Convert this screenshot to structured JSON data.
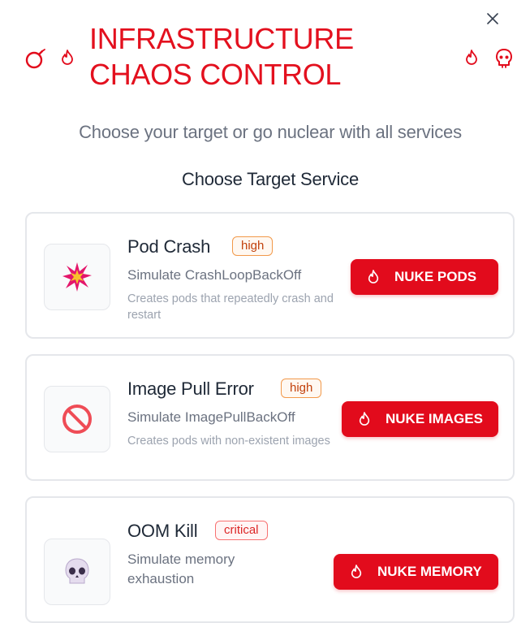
{
  "dialog": {
    "title_line1": "INFRASTRUCTURE",
    "title_line2": "CHAOS CONTROL",
    "subtitle": "Choose your target or go nuclear with all services",
    "section_title": "Choose Target Service",
    "close_icon": "close-icon",
    "header_icons": [
      "bomb-icon",
      "fire-icon",
      "fire-icon",
      "skull-icon"
    ]
  },
  "colors": {
    "accent": "#e20b1c",
    "badge_high": "#f2994a",
    "badge_critical": "#f87171"
  },
  "services": [
    {
      "name": "Pod Crash",
      "severity": "high",
      "description": "Simulate CrashLoopBackOff",
      "detail": "Creates pods that repeatedly crash and restart",
      "icon": "collision-icon",
      "button_label": "NUKE PODS"
    },
    {
      "name": "Image Pull Error",
      "severity": "high",
      "description": "Simulate ImagePullBackOff",
      "detail": "Creates pods with non-existent images",
      "icon": "prohibited-icon",
      "button_label": "NUKE IMAGES"
    },
    {
      "name": "OOM Kill",
      "severity": "critical",
      "description_line1": "Simulate memory",
      "description_line2": "exhaustion",
      "icon": "skull-icon",
      "button_label": "NUKE MEMORY"
    }
  ]
}
